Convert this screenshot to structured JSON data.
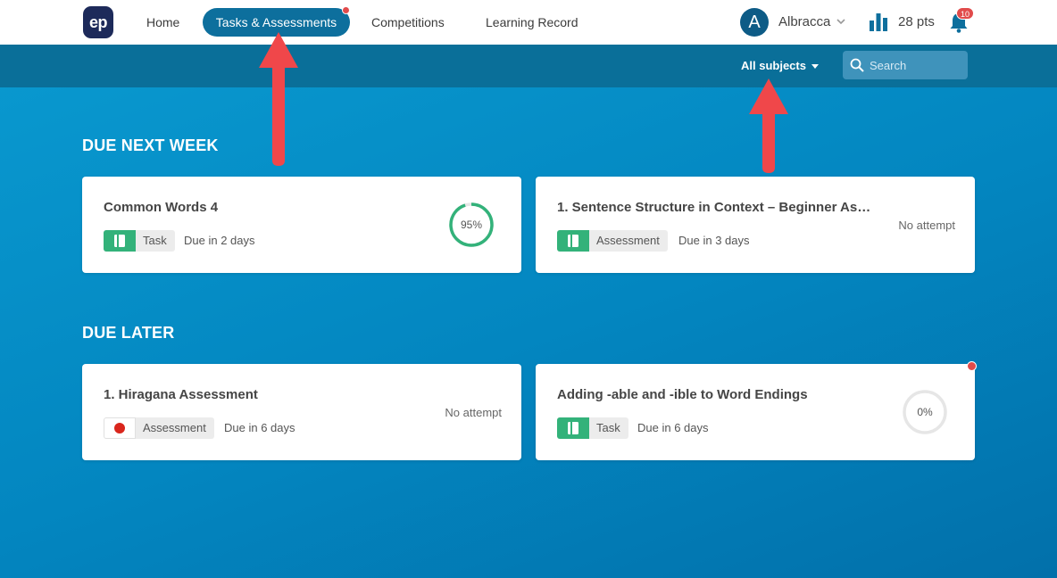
{
  "nav": {
    "logo": "ep",
    "items": [
      {
        "label": "Home"
      },
      {
        "label": "Tasks & Assessments",
        "active": true
      },
      {
        "label": "Competitions"
      },
      {
        "label": "Learning Record"
      }
    ],
    "user": {
      "initial": "A",
      "name": "Albracca"
    },
    "points": "28 pts",
    "notifications": "10"
  },
  "toolbar": {
    "subject_filter": "All subjects",
    "search_placeholder": "Search"
  },
  "sections": [
    {
      "title": "DUE NEXT WEEK",
      "cards": [
        {
          "title": "Common Words 4",
          "type": "Task",
          "due": "Due in 2 days",
          "progress": "95%",
          "progress_fraction": 0.95
        },
        {
          "title": "1. Sentence Structure in Context – Beginner As…",
          "type": "Assessment",
          "due": "Due in 3 days",
          "status": "No attempt"
        }
      ]
    },
    {
      "title": "DUE LATER",
      "cards": [
        {
          "title": "1. Hiragana Assessment",
          "type": "Assessment",
          "due": "Due in 6 days",
          "status": "No attempt"
        },
        {
          "title": "Adding -able and -ible to Word Endings",
          "type": "Task",
          "due": "Due in 6 days",
          "progress": "0%",
          "progress_fraction": 0.0
        }
      ]
    }
  ],
  "colors": {
    "accent": "#0d6f9d",
    "task_green": "#33b27a",
    "alert_red": "#e14b4b",
    "annotation_arrow": "#f0474a"
  }
}
